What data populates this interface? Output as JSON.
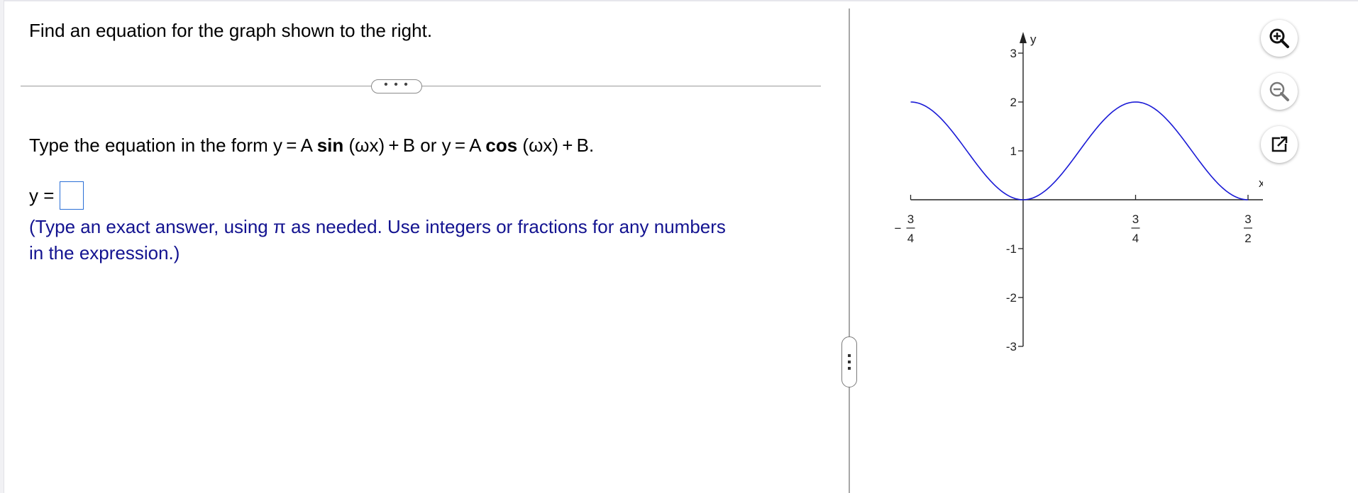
{
  "question": "Find an equation for the graph shown to the right.",
  "expand_button": "• • •",
  "instruction": {
    "prefix": "Type the equation in the form y = A ",
    "sin": "sin",
    "mid": " (ωx) + B or y = A ",
    "cos": "cos",
    "suffix": " (ωx) + B."
  },
  "answer": {
    "label": "y =",
    "value": ""
  },
  "hint_lines": [
    "(Type an exact answer, using π as needed. Use integers or fractions for any numbers",
    "in the expression.)"
  ],
  "graph": {
    "axis_x_label": "x",
    "axis_y_label": "y",
    "y_ticks": [
      "3",
      "2",
      "1",
      "-1",
      "-2",
      "-3"
    ],
    "x_ticks": [
      {
        "num": "3",
        "den": "4",
        "sign": "−"
      },
      {
        "num": "3",
        "den": "4",
        "sign": ""
      },
      {
        "num": "3",
        "den": "2",
        "sign": ""
      }
    ],
    "curve_color": "#1a1ad6"
  },
  "chart_data": {
    "type": "line",
    "xlim": [
      -0.75,
      1.5
    ],
    "ylim": [
      -3,
      3
    ],
    "x": [
      -0.75,
      -0.5,
      -0.25,
      0,
      0.25,
      0.5,
      0.75,
      1.0,
      1.25,
      1.5
    ],
    "y": [
      2,
      1.5,
      0.5,
      0,
      0.5,
      1.5,
      2,
      1.5,
      0.5,
      0
    ],
    "series": [
      {
        "values": [
          2,
          1.5,
          0.5,
          0,
          0.5,
          1.5,
          2,
          1.5,
          0.5,
          0
        ]
      }
    ],
    "grid": false
  },
  "tools": {
    "zoom_in": "zoom-in-icon",
    "zoom_out": "zoom-out-icon",
    "popout": "popout-icon"
  }
}
